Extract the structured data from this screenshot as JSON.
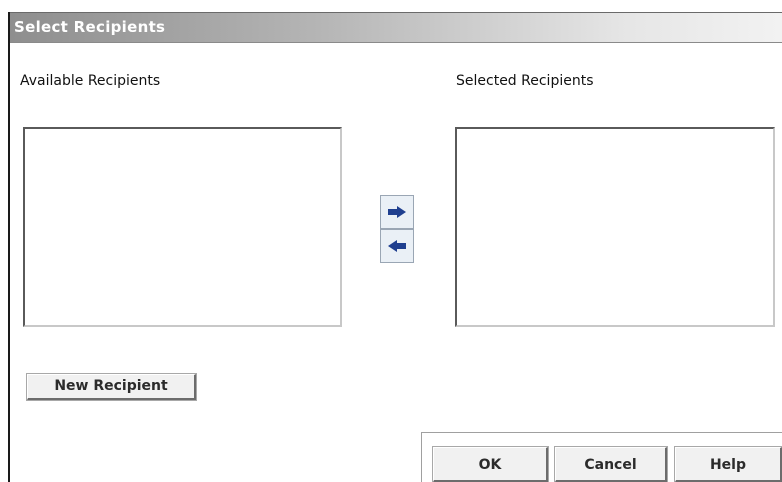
{
  "dialog": {
    "title": "Select Recipients"
  },
  "available": {
    "label": "Available Recipients",
    "items": []
  },
  "selected": {
    "label": "Selected Recipients",
    "items": []
  },
  "actions": {
    "new_recipient": "New Recipient",
    "ok": "OK",
    "cancel": "Cancel",
    "help": "Help"
  },
  "icons": {
    "move_right": "arrow-right-icon",
    "move_left": "arrow-left-icon"
  },
  "colors": {
    "arrow": "#1f3f8f",
    "title_text": "#ffffff"
  }
}
